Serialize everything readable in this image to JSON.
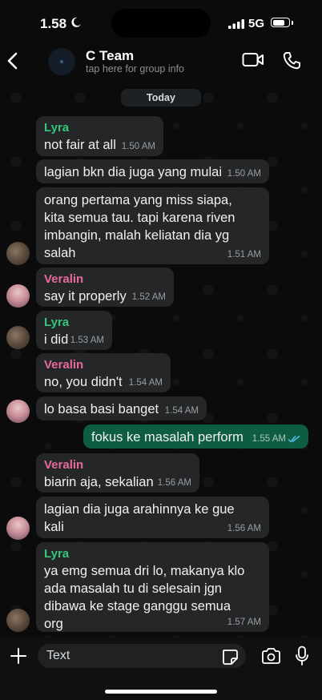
{
  "status_bar": {
    "time": "1.58",
    "network": "5G"
  },
  "header": {
    "title": "C Team",
    "subtitle": "tap here for group info"
  },
  "date_chip": "Today",
  "messages": [
    {
      "sender": "Lyra",
      "lines": [
        "not fair at all"
      ],
      "time": "1.50 AM"
    },
    {
      "sender": "",
      "lines": [
        "lagian bkn dia juga yang mulai"
      ],
      "time": "1.50 AM"
    },
    {
      "sender": "",
      "lines": [
        "orang pertama yang miss siapa,",
        "kita semua tau. tapi karena riven",
        "imbangin, malah keliatan dia yg",
        "salah"
      ],
      "time": "1.51 AM"
    },
    {
      "sender": "Veralin",
      "lines": [
        "say it properly"
      ],
      "time": "1.52 AM"
    },
    {
      "sender": "Lyra",
      "lines": [
        "i did"
      ],
      "time": "1.53 AM"
    },
    {
      "sender": "Veralin",
      "lines": [
        "no, you didn't"
      ],
      "time": "1.54 AM"
    },
    {
      "sender": "",
      "lines": [
        "lo basa basi banget"
      ],
      "time": "1.54 AM"
    },
    {
      "sender": "",
      "lines": [
        "fokus ke masalah perform"
      ],
      "time": "1.55 AM",
      "outgoing": true
    },
    {
      "sender": "Veralin",
      "lines": [
        "biarin aja, sekalian"
      ],
      "time": "1.56 AM"
    },
    {
      "sender": "",
      "lines": [
        "lagian dia juga arahinnya ke gue",
        "kali"
      ],
      "time": "1.56 AM"
    },
    {
      "sender": "Lyra",
      "lines": [
        "ya emg semua dri lo, makanya klo",
        "ada masalah tu di selesain jgn",
        "dibawa ke stage ganggu semua",
        "org"
      ],
      "time": "1.57 AM"
    }
  ],
  "composer": {
    "placeholder": "Text"
  },
  "icons": {
    "back": "chevron-left-icon",
    "video": "video-camera-icon",
    "phone": "phone-icon",
    "plus": "plus-icon",
    "sticker": "sticker-icon",
    "camera": "camera-icon",
    "mic": "microphone-icon",
    "read_receipt": "double-check-icon"
  },
  "colors": {
    "lyra": "#34c77b",
    "veralin": "#e76a9b",
    "outgoing_bubble": "#0f5c45",
    "incoming_bubble": "#242628",
    "read_ticks": "#53bdeb"
  }
}
